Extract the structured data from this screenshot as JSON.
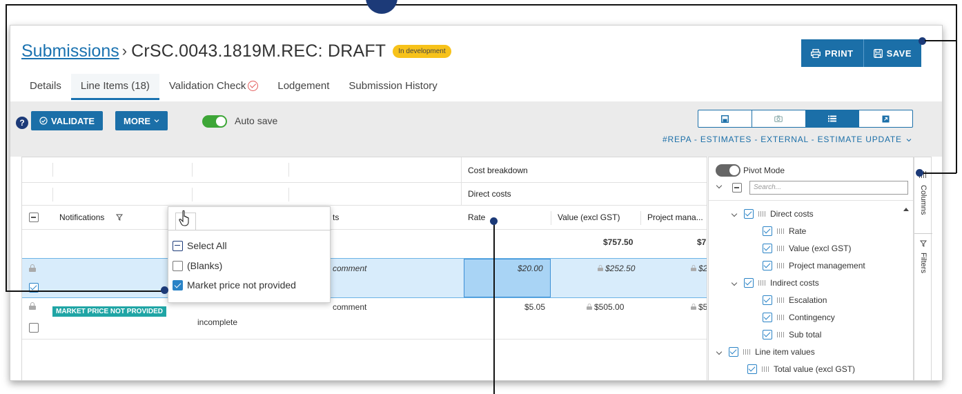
{
  "breadcrumb": {
    "parent": "Submissions",
    "separator": "›",
    "current": "CrSC.0043.1819M.REC: DRAFT",
    "status_badge": "In development"
  },
  "actions": {
    "print": "PRINT",
    "save": "SAVE"
  },
  "tabs": [
    {
      "label": "Details",
      "active": false
    },
    {
      "label": "Line Items (18)",
      "active": true
    },
    {
      "label": "Validation Check",
      "active": false
    },
    {
      "label": "Lodgement",
      "active": false
    },
    {
      "label": "Submission History",
      "active": false
    }
  ],
  "toolbar": {
    "help": "?",
    "validate": "VALIDATE",
    "more": "MORE",
    "auto_save": "Auto save",
    "estimate_link": "#REPA - ESTIMATES - EXTERNAL - ESTIMATE UPDATE"
  },
  "view_icons": [
    "save-layout-icon",
    "camera-icon",
    "list-icon",
    "export-icon"
  ],
  "grid": {
    "group_header": "Cost breakdown",
    "subgroup_header": "Direct costs",
    "columns": {
      "notifications": "Notifications",
      "comments_partial": "ts",
      "rate": "Rate",
      "value": "Value (excl GST)",
      "project_mgmt": "Project mana..."
    },
    "totals": {
      "value": "$757.50",
      "project_mgmt": "$7!"
    },
    "rows": [
      {
        "comment": "comment",
        "rate": "$20.00",
        "value": "$252.50",
        "project_mgmt": "$2"
      },
      {
        "badge": "MARKET PRICE NOT PROVIDED",
        "status": "incomplete",
        "comment": "comment",
        "rate": "$5.05",
        "value": "$505.00",
        "project_mgmt": "$5"
      }
    ]
  },
  "filter_popup": {
    "items": [
      {
        "label": "Select All",
        "state": "partial"
      },
      {
        "label": "(Blanks)",
        "state": "unchecked"
      },
      {
        "label": "Market price not provided",
        "state": "checked"
      }
    ]
  },
  "column_panel": {
    "pivot_mode": "Pivot Mode",
    "search_placeholder": "Search...",
    "items": [
      {
        "label": "Direct costs",
        "level": 1,
        "group": true
      },
      {
        "label": "Rate",
        "level": 2
      },
      {
        "label": "Value (excl GST)",
        "level": 2
      },
      {
        "label": "Project management",
        "level": 2
      },
      {
        "label": "Indirect costs",
        "level": 1,
        "group": true
      },
      {
        "label": "Escalation",
        "level": 2
      },
      {
        "label": "Contingency",
        "level": 2
      },
      {
        "label": "Sub total",
        "level": 2
      },
      {
        "label": "Line item values",
        "level": 0,
        "group": true
      },
      {
        "label": "Total value (excl GST)",
        "level": 1
      }
    ],
    "side_tabs": {
      "columns": "Columns",
      "filters": "Filters"
    }
  },
  "colors": {
    "accent": "#1b6fa8",
    "callout": "#1c3a78",
    "badge_yellow": "#f7c21a",
    "badge_teal": "#20a5a5",
    "toggle_on": "#3da637"
  }
}
